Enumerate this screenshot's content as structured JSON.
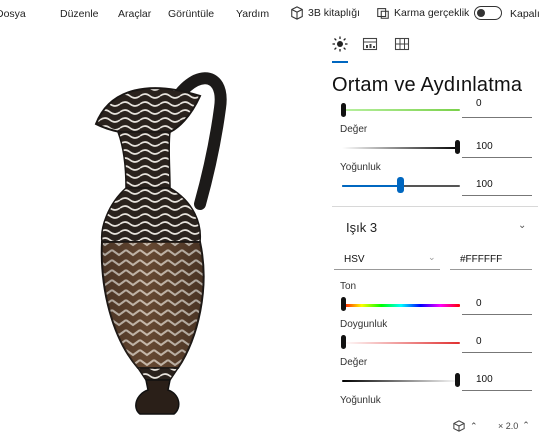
{
  "menu": {
    "items": [
      "Dosya",
      "Düzenle",
      "Araçlar",
      "Görüntüle",
      "Yardım"
    ],
    "library_label": "3B kitaplığı",
    "mixed_reality_label": "Karma gerçeklik",
    "toggle_state": "Kapalı"
  },
  "panel": {
    "tabs": [
      "sun-icon",
      "stats-icon",
      "grid-icon"
    ],
    "title": "Ortam ve Aydınlatma",
    "top_value": "0",
    "deger_label": "Değer",
    "deger_value": "100",
    "yogunluk_label": "Yoğunluk",
    "yogunluk_value": "100",
    "section_title": "Işık 3",
    "color_mode": "HSV",
    "hex_value": "#FFFFFF",
    "ton_label": "Ton",
    "ton_value": "0",
    "doygunluk_label": "Doygunluk",
    "doygunluk_value": "0",
    "deger2_label": "Değer",
    "deger2_value": "100",
    "yogunluk2_label": "Yoğunluk"
  },
  "status": {
    "zoom": "× 2.0"
  },
  "colors": {
    "accent": "#0067c0",
    "green_track": "#7ad14a",
    "red_track": "#e03030"
  }
}
